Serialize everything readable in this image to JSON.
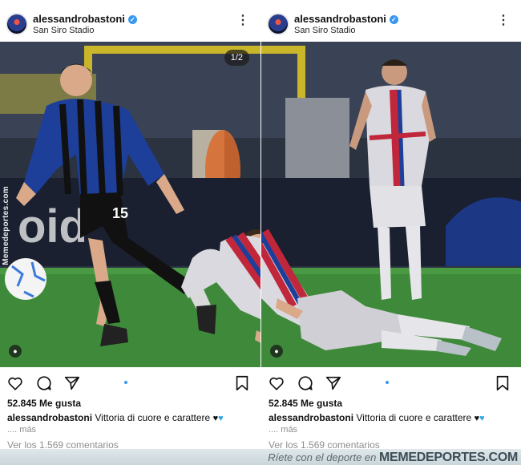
{
  "posts": [
    {
      "username": "alessandrobastoni",
      "location": "San Siro Stadio",
      "counter": "1/2",
      "likes": "52.845 Me gusta",
      "caption_user": "alessandrobastoni",
      "caption_text": "Vittoria di cuore e carattere",
      "caption_emoji_1": "♥",
      "caption_emoji_2": "♥",
      "more": ".... más",
      "comments": "Ver los 1.569 comentarios",
      "watermark": "Memedeportes.com"
    },
    {
      "username": "alessandrobastoni",
      "location": "San Siro Stadio",
      "likes": "52.845 Me gusta",
      "caption_user": "alessandrobastoni",
      "caption_text": "Vittoria di cuore e carattere",
      "caption_emoji_1": "♥",
      "caption_emoji_2": "♥",
      "more": ".... más",
      "comments": "Ver los 1.569 comentarios"
    }
  ],
  "footer": {
    "tagline": "Ríete con el deporte en",
    "site": "MEMEDEPORTES.COM"
  },
  "icons": [
    "avatar",
    "verified-icon",
    "more-options-icon",
    "heart-icon",
    "comment-icon",
    "share-icon",
    "bookmark-icon",
    "tag-people-icon"
  ],
  "colors": {
    "verified": "#3897f0",
    "pitch": "#3f8a3a",
    "inter_blue": "#1d3f9a",
    "barca_grey": "#d9d9df"
  }
}
